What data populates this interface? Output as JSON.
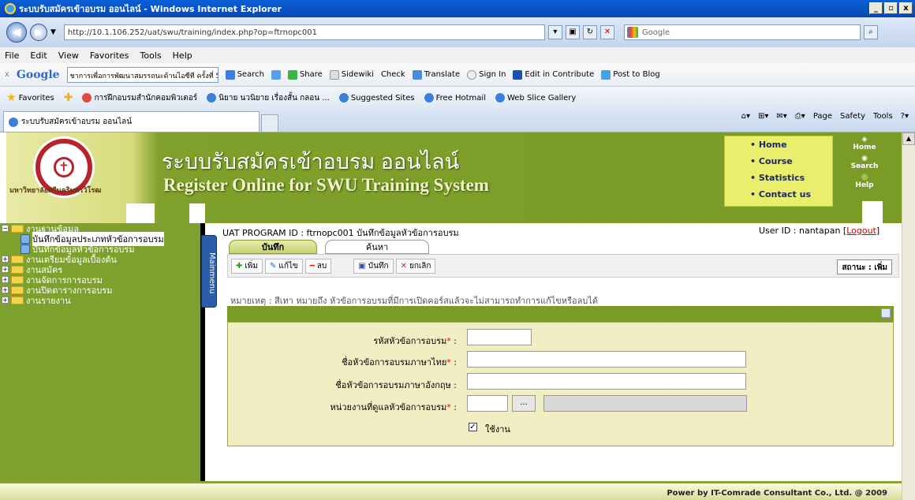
{
  "window": {
    "title": "ระบบรับสมัครเข้าอบรม ออนไลน์ - Windows Internet Explorer",
    "btn_min": "_",
    "btn_max": "▫",
    "btn_close": "x"
  },
  "address": {
    "url": "http://10.1.106.252/uat/swu/training/index.php?op=ftrnopc001",
    "search_placeholder": "Google"
  },
  "menubar": [
    "File",
    "Edit",
    "View",
    "Favorites",
    "Tools",
    "Help"
  ],
  "gtoolbar": {
    "logo": "Google",
    "query": "ชาการเพื่อการพัฒนาสมรรถนะด้านไอซีที ครั้งที่ 5",
    "items": [
      "Search",
      "Share",
      "Sidewiki",
      "Check",
      "Translate",
      "Sign In",
      "Edit in Contribute",
      "Post to Blog"
    ]
  },
  "favorites": {
    "label": "Favorites",
    "items": [
      "การฝึกอบรมสำนักคอมพิวเตอร์",
      "นิยาย นวนิยาย เรื่องสั้น กลอน ...",
      "Suggested Sites",
      "Free Hotmail",
      "Web Slice Gallery"
    ]
  },
  "tab": {
    "title": "ระบบรับสมัครเข้าอบรม ออนไลน์",
    "commands": [
      "Page",
      "Safety",
      "Tools"
    ]
  },
  "header": {
    "title_th": "ระบบรับสมัครเข้าอบรม ออนไลน์",
    "title_en": "Register Online for SWU Training System",
    "university": "มหาวิทยาลัยศรีนครินทรวิโรฒ",
    "nav": [
      "Home",
      "Course",
      "Statistics",
      "Contact us"
    ],
    "side_icons": [
      "Home",
      "Search",
      "Help"
    ]
  },
  "tree": {
    "items": [
      {
        "label": "งานฐานข้อมูล",
        "level": 0,
        "expand": "−"
      },
      {
        "label": "บันทึกข้อมูลประเภทหัวข้อการอบรม",
        "level": 1
      },
      {
        "label": "บันทึกข้อมูลหัวข้อการอบรม",
        "level": 1
      },
      {
        "label": "งานเตรียมข้อมูลเบื้องต้น",
        "level": 0,
        "expand": "+"
      },
      {
        "label": "งานสมัคร",
        "level": 0,
        "expand": "+"
      },
      {
        "label": "งานจัดการการอบรม",
        "level": 0,
        "expand": "+"
      },
      {
        "label": "งานปิดตารางการอบรม",
        "level": 0,
        "expand": "+"
      },
      {
        "label": "งานรายงาน",
        "level": 0,
        "expand": "+"
      }
    ],
    "mainmenu": "Mainmenu"
  },
  "content": {
    "program_line": "UAT   PROGRAM ID : ftrnopc001 บันทึกข้อมูลหัวข้อการอบรม",
    "user_label": "User ID : nantapan",
    "logout": "Logout",
    "tabs": [
      "บันทึก",
      "ค้นหา"
    ],
    "toolbar": [
      "เพิ่ม",
      "แก้ไข",
      "ลบ",
      "บันทึก",
      "ยกเลิก"
    ],
    "status": "สถานะ : เพิ่ม",
    "remark": "หมายเหตุ :   สีเทา หมายถึง หัวข้อการอบรมที่มีการเปิดคอร์สแล้วจะไม่สามารถทำการแก้ไขหรือลบได้",
    "form": {
      "code_label": "รหัสหัวข้อการอบรม",
      "name_th_label": "ชื่อหัวข้อการอบรมภาษาไทย",
      "name_en_label": "ชื่อหัวข้อการอบรมภาษาอังกฤษ",
      "unit_label": "หน่วยงานที่ดูแลหัวข้อการอบรม",
      "colon": ":",
      "browse": "...",
      "active_label": "ใช้งาน"
    }
  },
  "footer": "Power by IT-Comrade Consultant Co., Ltd. @ 2009"
}
